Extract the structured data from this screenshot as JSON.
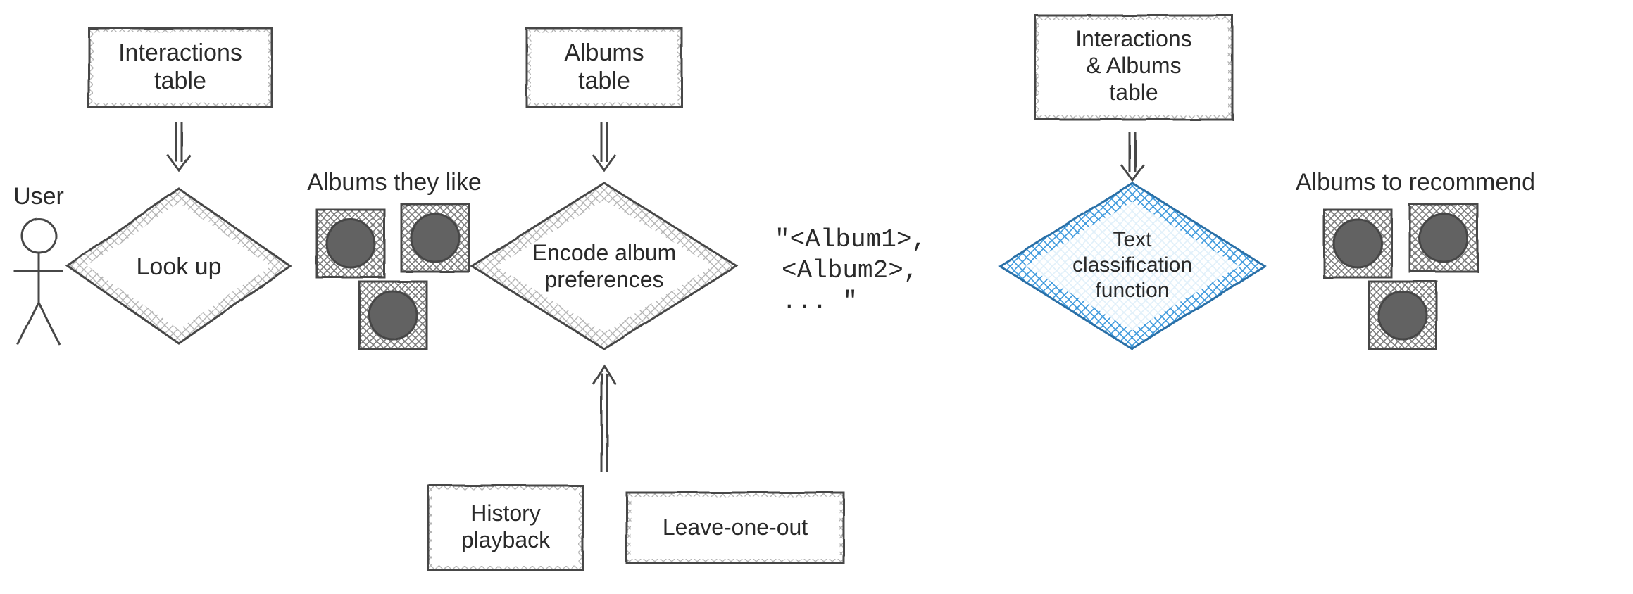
{
  "nodes": {
    "user_label": "User",
    "interactions_table_l1": "Interactions",
    "interactions_table_l2": "table",
    "lookup": "Look up",
    "albums_they_like": "Albums they like",
    "albums_table_l1": "Albums",
    "albums_table_l2": "table",
    "encode_l1": "Encode album",
    "encode_l2": "preferences",
    "history_l1": "History",
    "history_l2": "playback",
    "leave_one_out": "Leave-one-out",
    "encoded_l1": "\"<Album1>,",
    "encoded_l2": "<Album2>,",
    "encoded_l3": "... \"",
    "interactions_albums_l1": "Interactions",
    "interactions_albums_l2": "& Albums",
    "interactions_albums_l3": "table",
    "classifier_l1": "Text",
    "classifier_l2": "classification",
    "classifier_l3": "function",
    "albums_to_recommend": "Albums to recommend"
  },
  "colors": {
    "stroke": "#474747",
    "hatch_grey": "#adadad",
    "hatch_grey_dark": "#808080",
    "hatch_blue": "#2f90d8",
    "text": "#2a2a2a"
  }
}
